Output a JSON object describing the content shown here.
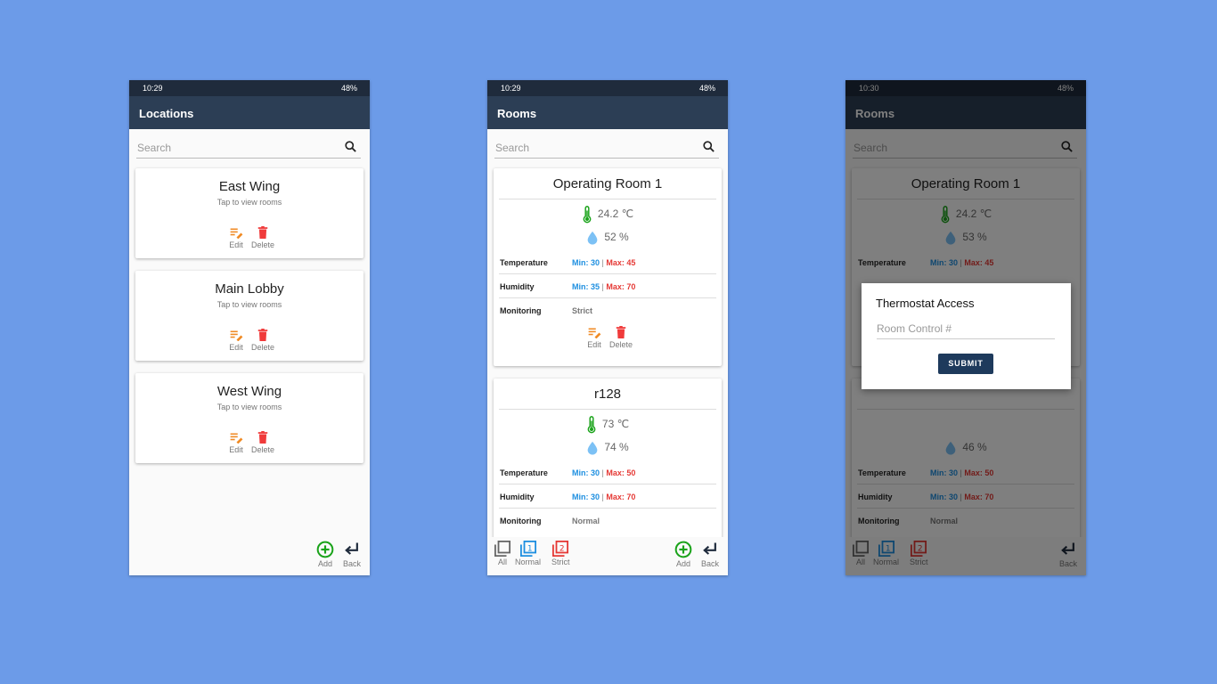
{
  "colors": {
    "background": "#6c9be8",
    "appbar": "#2c3e55",
    "statusbar": "#1f2b3c",
    "edit": "#f08a24",
    "delete": "#f03b3b",
    "min": "#1e8fe0",
    "max": "#e53935",
    "add": "#1aa31a",
    "thermometer": "#1aa31a",
    "drop": "#7cc1f5",
    "submit": "#1e3a5c"
  },
  "screens": [
    {
      "status": {
        "time": "10:29",
        "battery": "48%"
      },
      "title": "Locations",
      "search_placeholder": "Search",
      "locations": [
        {
          "name": "East Wing",
          "subtitle": "Tap to view rooms",
          "edit": "Edit",
          "delete": "Delete"
        },
        {
          "name": "Main Lobby",
          "subtitle": "Tap to view rooms",
          "edit": "Edit",
          "delete": "Delete"
        },
        {
          "name": "West Wing",
          "subtitle": "Tap to view rooms",
          "edit": "Edit",
          "delete": "Delete"
        }
      ],
      "bottom": {
        "add": "Add",
        "back": "Back"
      }
    },
    {
      "status": {
        "time": "10:29",
        "battery": "48%"
      },
      "title": "Rooms",
      "search_placeholder": "Search",
      "rooms": [
        {
          "name": "Operating Room 1",
          "temperature": "24.2 ℃",
          "humidity": "52 %",
          "rows": [
            {
              "label": "Temperature",
              "min": "Min: 30",
              "max": "Max: 45"
            },
            {
              "label": "Humidity",
              "min": "Min: 35",
              "max": "Max: 70"
            },
            {
              "label": "Monitoring",
              "value": "Strict"
            }
          ],
          "edit": "Edit",
          "delete": "Delete"
        },
        {
          "name": "r128",
          "temperature": "73 ℃",
          "humidity": "74 %",
          "rows": [
            {
              "label": "Temperature",
              "min": "Min: 30",
              "max": "Max: 50"
            },
            {
              "label": "Humidity",
              "min": "Min: 30",
              "max": "Max: 70"
            },
            {
              "label": "Monitoring",
              "value": "Normal"
            }
          ]
        }
      ],
      "bottom": {
        "all": "All",
        "normal": "Normal",
        "strict": "Strict",
        "add": "Add",
        "back": "Back"
      }
    },
    {
      "status": {
        "time": "10:30",
        "battery": "48%"
      },
      "title": "Rooms",
      "search_placeholder": "Search",
      "rooms": [
        {
          "name": "Operating Room 1",
          "temperature": "24.2 ℃",
          "humidity": "53 %",
          "rows": [
            {
              "label": "Temperature",
              "min": "Min: 30",
              "max": "Max: 45"
            }
          ]
        },
        {
          "humidity": "46 %",
          "rows": [
            {
              "label": "Temperature",
              "min": "Min: 30",
              "max": "Max: 50"
            },
            {
              "label": "Humidity",
              "min": "Min: 30",
              "max": "Max: 70"
            },
            {
              "label": "Monitoring",
              "value": "Normal"
            }
          ]
        }
      ],
      "bottom": {
        "all": "All",
        "normal": "Normal",
        "strict": "Strict",
        "back": "Back"
      },
      "dialog": {
        "title": "Thermostat Access",
        "placeholder": "Room Control #",
        "submit": "SUBMIT"
      }
    }
  ]
}
